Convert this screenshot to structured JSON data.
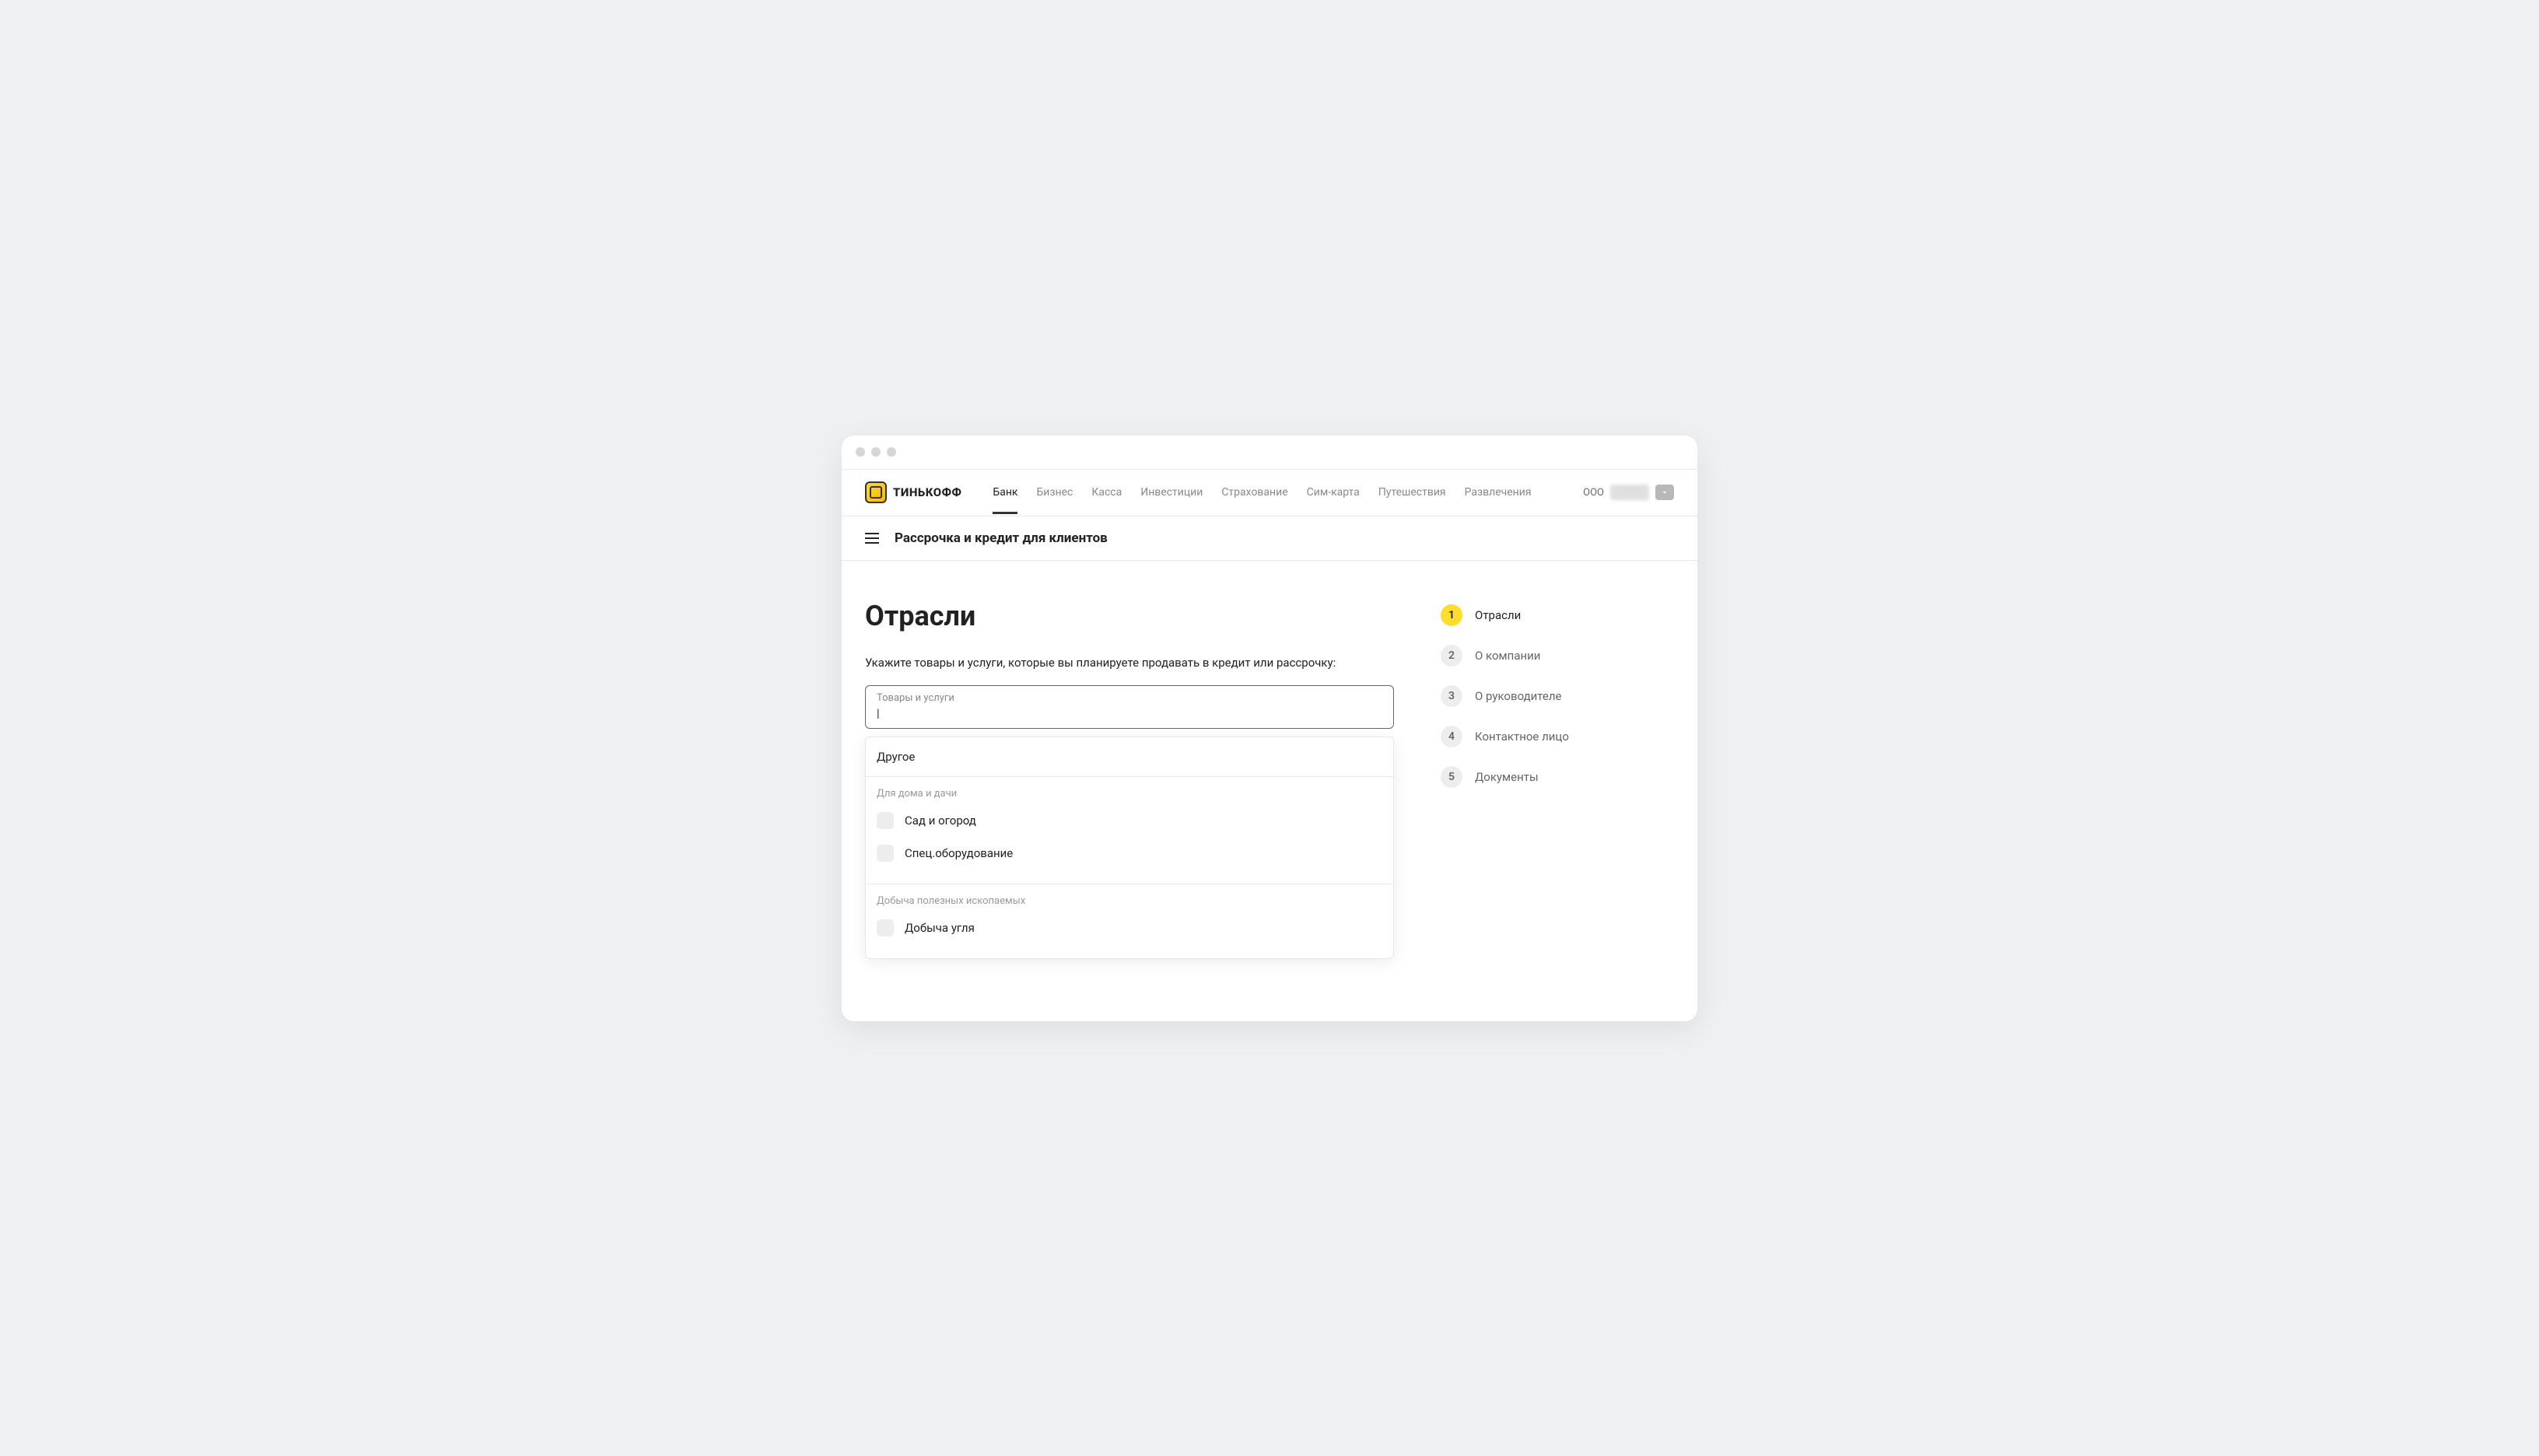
{
  "logo": "ТИНЬКОФФ",
  "nav": [
    {
      "label": "Банк",
      "active": true
    },
    {
      "label": "Бизнес",
      "active": false
    },
    {
      "label": "Касса",
      "active": false
    },
    {
      "label": "Инвестиции",
      "active": false
    },
    {
      "label": "Страхование",
      "active": false
    },
    {
      "label": "Сим-карта",
      "active": false
    },
    {
      "label": "Путешествия",
      "active": false
    },
    {
      "label": "Развлечения",
      "active": false
    }
  ],
  "account_prefix": "ООО",
  "subheader": "Рассрочка и кредит для клиентов",
  "page_title": "Отрасли",
  "hint": "Укажите товары и услуги, которые вы планируете продавать в кредит или рассрочку:",
  "input": {
    "label": "Товары и услуги",
    "value": ""
  },
  "dropdown": {
    "top_option": "Другое",
    "sections": [
      {
        "title": "Для дома и дачи",
        "options": [
          "Сад и огород",
          "Спец.оборудование"
        ]
      },
      {
        "title": "Добыча полезных ископаемых",
        "options": [
          "Добыча угля"
        ]
      }
    ]
  },
  "steps": [
    {
      "num": "1",
      "label": "Отрасли",
      "active": true
    },
    {
      "num": "2",
      "label": "О компании",
      "active": false
    },
    {
      "num": "3",
      "label": "О руководителе",
      "active": false
    },
    {
      "num": "4",
      "label": "Контактное лицо",
      "active": false
    },
    {
      "num": "5",
      "label": "Документы",
      "active": false
    }
  ]
}
